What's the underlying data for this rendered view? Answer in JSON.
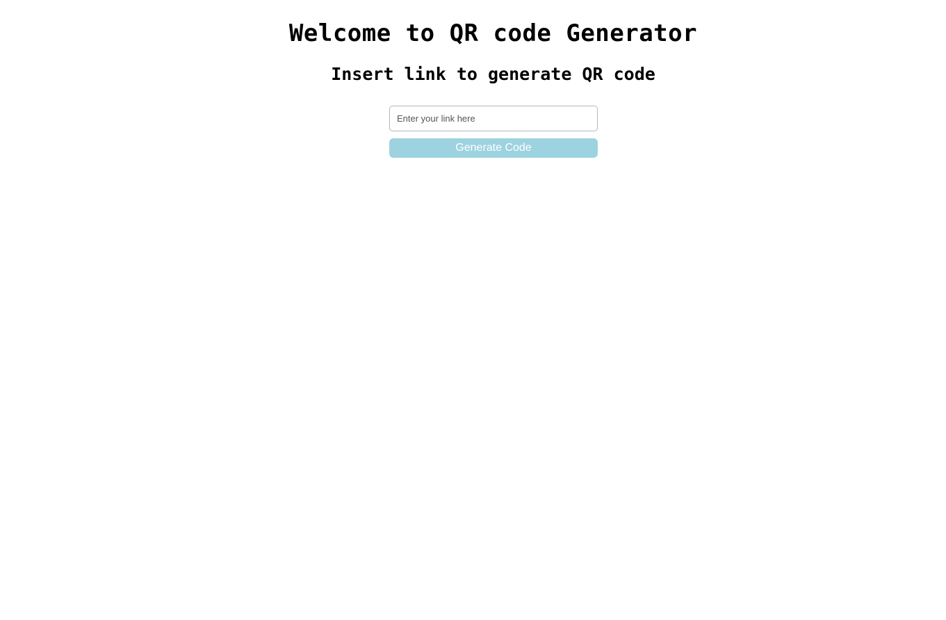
{
  "page": {
    "title": "Welcome to QR code Generator",
    "subtitle": "Insert link to generate QR code"
  },
  "form": {
    "link_input": {
      "value": "",
      "placeholder": "Enter your link here"
    },
    "generate_label": "Generate Code"
  },
  "colors": {
    "button_background": "#9dd3e0",
    "button_text": "#ffffff",
    "input_border": "#b5b5b5",
    "page_background": "#ffffff"
  }
}
